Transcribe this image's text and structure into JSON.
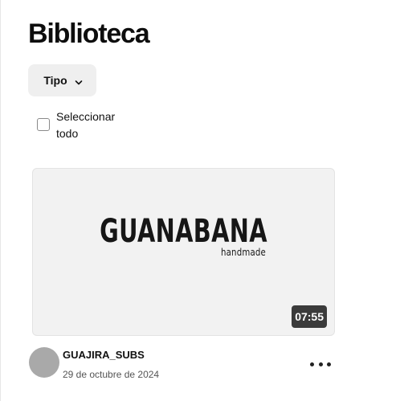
{
  "header": {
    "title": "Biblioteca"
  },
  "filters": {
    "type_label": "Tipo",
    "type_icon": "chevron-down-icon"
  },
  "selection": {
    "select_all_label": "Seleccionar todo",
    "checked": false
  },
  "videos": [
    {
      "thumbnail_logo": "GUANABANA",
      "thumbnail_sub": "handmade",
      "duration": "07:55",
      "channel": "GUAJIRA_SUBS",
      "date": "29 de octubre de 2024",
      "more_icon": "more-horizontal-icon"
    }
  ],
  "colors": {
    "background": "#ffffff",
    "filter_bg": "#efefef",
    "thumb_bg": "#f2f2f2",
    "duration_bg": "#3b3b3b",
    "avatar": "#a9a9a9"
  }
}
